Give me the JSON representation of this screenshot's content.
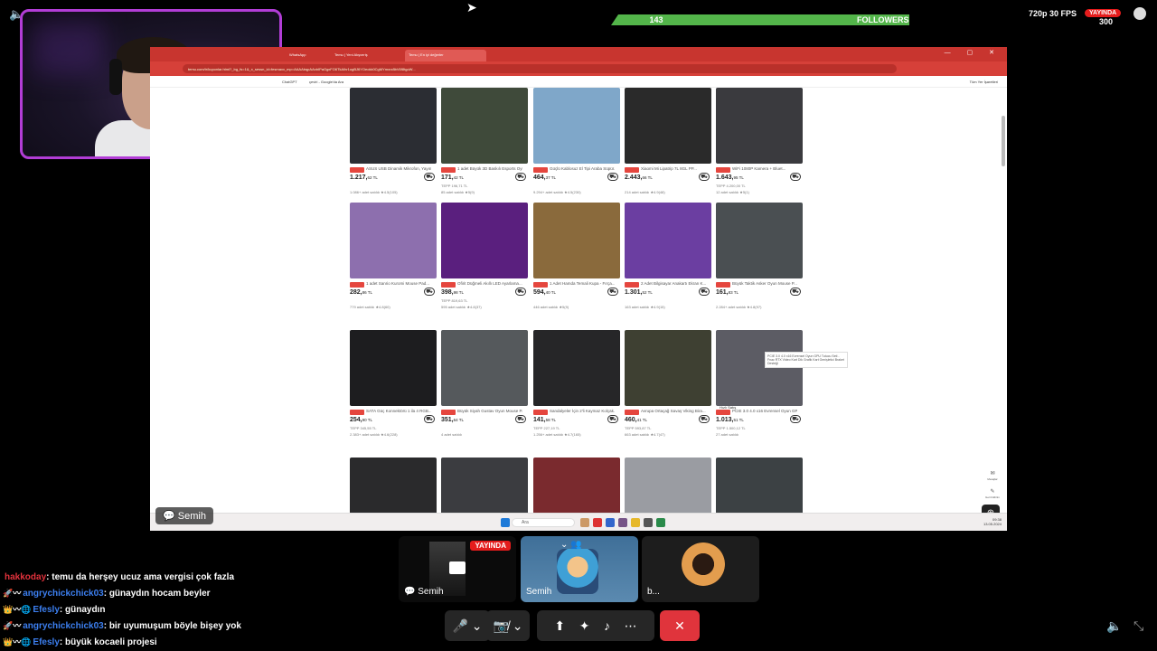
{
  "stream": {
    "fps_label": "720p 30 FPS",
    "live_label": "YAYINDA",
    "viewer_count": "300",
    "followers_count": "143",
    "followers_label": "FOLLOWERS"
  },
  "browser": {
    "tabs": [
      "WhatsApp",
      "Temu | Yeni Alışveriş",
      "Temu | En iyi değerler"
    ],
    "url": "temu.com/tr/kuponlar.html?_bg_fs=1&_x_sessn_id=fesmaxx_mp=AAAAbqpAAxbIPaGgxFO6TkAlhr1ogBJ6YOeokk0CgMYmxrz8bV6f8tgoW...",
    "bookmarks": [
      "ChatGPT",
      "çeviri - Google'da Ara"
    ],
    "bookmarks_right": "Tüm Yer İşaretleri"
  },
  "products": [
    {
      "title": "ASUS USB Dinamik Mikrofon, Yayın...",
      "price": "1.217,",
      "cents": "62 TL",
      "old": "",
      "sold": "1.086+ adet satıldı  ★4.5(105)",
      "color": "#2b2d33"
    },
    {
      "title": "1 adet Büyük 3D Baskılı Esports Oyun...",
      "price": "171,",
      "cents": "42 TL",
      "old": "TEPP 196,71 TL",
      "sold": "85 adet satıldı  ★5(9)",
      "color": "#3f4a3a"
    },
    {
      "title": "Güçlü Kablosuz El Tipi Araba Süpür...",
      "price": "464,",
      "cents": "37 TL",
      "old": "",
      "sold": "9.294+ adet satıldı  ★4.5(230)",
      "color": "#7fa7c9"
    },
    {
      "title": "Xiaomi Mi Lipatrip 7L 8GL PP...",
      "price": "2.443,",
      "cents": "66 TL",
      "old": "",
      "sold": "214 adet satıldı  ★4.9(48)",
      "color": "#2a2a2a"
    },
    {
      "title": "WiFi 1080P Kamera + Bluet...",
      "price": "1.643,",
      "cents": "95 TL",
      "old": "TEPP 4.200,00 TL",
      "sold": "12 adet satıldı  ★5(1)",
      "color": "#3a3a3e"
    },
    {
      "title": "1 adet Sanrio Kuromi Mouse Pad...",
      "price": "282,",
      "cents": "86 TL",
      "old": "",
      "sold": "779 adet satıldı  ★4.8(60)",
      "color": "#8d6fae"
    },
    {
      "title": "Ofirit Düğmeli Akıllı LED Ayarlama...",
      "price": "398,",
      "cents": "98 TL",
      "old": "TEPP 819,63 TL",
      "sold": "595 adet satıldı  ★4.8(37)",
      "color": "#5a1f7e"
    },
    {
      "title": "1 Adet Hamda Temali Kupa - Fırça...",
      "price": "594,",
      "cents": "40 TL",
      "old": "",
      "sold": "446 adet satıldı  ★5(9)",
      "color": "#8a6a3c"
    },
    {
      "title": "2 Adet Bilgisayar Anakartı Ekran K...",
      "price": "1.301,",
      "cents": "52 TL",
      "old": "",
      "sold": "163 adet satıldı  ★4.9(15)",
      "color": "#6b3ea1"
    },
    {
      "title": "Büyük Taktik Asker Oyun Mouse P...",
      "price": "161,",
      "cents": "83 TL",
      "old": "",
      "sold": "2.284+ adet satıldı  ★4.8(97)",
      "color": "#4a4f52"
    },
    {
      "title": "SATA Güç Konnektörü 1 ila 4 RGB...",
      "price": "254,",
      "cents": "90 TL",
      "old": "TEPP 345,55 TL",
      "sold": "2.383+ adet satıldı  ★4.6(228)",
      "color": "#1d1d1f"
    },
    {
      "title": "Büyük Siyah Gustav Oyun Mouse Pad...",
      "price": "351,",
      "cents": "64 TL",
      "old": "",
      "sold": "4 adet satıldı",
      "color": "#55595c"
    },
    {
      "title": "Sandalyeler İçin 2'li Kaymaz Kolçak...",
      "price": "141,",
      "cents": "58 TL",
      "old": "TEPP 227,19 TL",
      "sold": "1.256+ adet satıldı  ★4.7(165)",
      "color": "#262628"
    },
    {
      "title": "Avrupa Ortaçağ Savaş Viking Bira...",
      "price": "460,",
      "cents": "41 TL",
      "old": "TEPP 593,87 TL",
      "sold": "663 adet satıldı  ★4.7(47)",
      "color": "#3e4032"
    },
    {
      "title": "PCIE 3.0 4.0 x16 Evrensel Oyun GP...",
      "price": "1.013,",
      "cents": "51 TL",
      "old": "TEPP 1.500,12 TL",
      "sold": "27 adet satıldı",
      "color": "#5c5c64"
    },
    {
      "title": "",
      "price": "",
      "cents": "",
      "old": "",
      "sold": "",
      "color": "#2a2a2c"
    },
    {
      "title": "",
      "price": "",
      "cents": "",
      "old": "",
      "sold": "",
      "color": "#3b3c40"
    },
    {
      "title": "",
      "price": "",
      "cents": "",
      "old": "",
      "sold": "",
      "color": "#7a2a2e"
    },
    {
      "title": "",
      "price": "",
      "cents": "",
      "old": "",
      "sold": "",
      "color": "#9a9ca2"
    },
    {
      "title": "",
      "price": "",
      "cents": "",
      "old": "",
      "sold": "",
      "color": "#3c4144"
    }
  ],
  "tooltip": "PCIE 3.0 4.0 x16 Evrensel Oyun GPU Tutucu Seti - Fnac RTX Video Kart Dik Grafik Kart Genişletici Braket Desteği",
  "hizli_label": "Hızlı Satış",
  "side_labels": [
    "Mesajlar",
    "Geri bildirim"
  ],
  "taskbar": {
    "search": "Ara",
    "time": "09:38",
    "date": "13.05.2024"
  },
  "sharer_label": "Semih",
  "participants": [
    {
      "name": "Semih",
      "live": "YAYINDA"
    },
    {
      "name": "Semih"
    },
    {
      "name": "b..."
    }
  ],
  "chat": [
    {
      "user": "hakkoday",
      "color": "#e2323c",
      "badge": "",
      "msg": "temu da herşey ucuz ama vergisi çok fazla"
    },
    {
      "user": "angrychickchick03",
      "color": "#3c7ff0",
      "badge": "🚀〰",
      "msg": "günaydın hocam beyler"
    },
    {
      "user": "Efesly",
      "color": "#3c7ff0",
      "badge": "👑〰🌐",
      "msg": "günaydın"
    },
    {
      "user": "angrychickchick03",
      "color": "#3c7ff0",
      "badge": "🚀〰",
      "msg": "bir uyumuşum böyle bişey yok"
    },
    {
      "user": "Efesly",
      "color": "#3c7ff0",
      "badge": "👑〰🌐",
      "msg": "büyük kocaeli projesi"
    }
  ]
}
